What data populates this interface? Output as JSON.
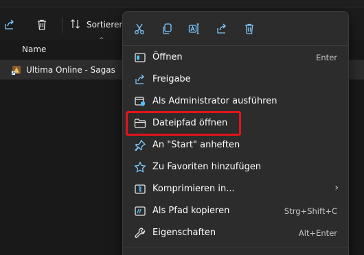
{
  "toolbar": {
    "share_icon": "share-icon",
    "delete_icon": "trash-icon",
    "sort_label": "Sortieren"
  },
  "file_list": {
    "column_name": "Name",
    "file_name": "Ultima Online - Sagas"
  },
  "context_menu": {
    "quick_actions": [
      "cut-icon",
      "copy-icon",
      "rename-icon",
      "share-icon",
      "trash-icon"
    ],
    "items": [
      {
        "label": "Öffnen",
        "shortcut": "Enter",
        "icon": "open-app-icon"
      },
      {
        "label": "Freigabe",
        "shortcut": "",
        "icon": "share-icon"
      },
      {
        "label": "Als Administrator ausführen",
        "shortcut": "",
        "icon": "shield-icon"
      },
      {
        "label": "Dateipfad öffnen",
        "shortcut": "",
        "icon": "folder-icon"
      },
      {
        "label": "An \"Start\" anheften",
        "shortcut": "",
        "icon": "pin-icon"
      },
      {
        "label": "Zu Favoriten hinzufügen",
        "shortcut": "",
        "icon": "star-icon"
      },
      {
        "label": "Komprimieren in...",
        "shortcut": "",
        "icon": "archive-icon"
      },
      {
        "label": "Als Pfad kopieren",
        "shortcut": "Strg+Shift+C",
        "icon": "path-copy-icon"
      },
      {
        "label": "Eigenschaften",
        "shortcut": "Alt+Enter",
        "icon": "wrench-icon"
      }
    ]
  },
  "colors": {
    "accent": "#4cc2ff",
    "highlight": "#e4141b",
    "menu_bg": "#2c2c2c"
  }
}
